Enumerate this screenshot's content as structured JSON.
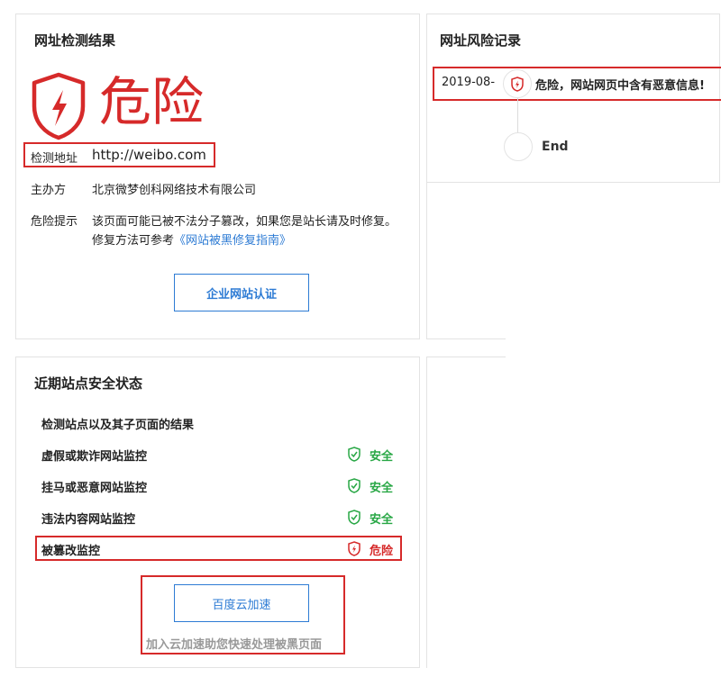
{
  "result": {
    "title": "网址检测结果",
    "verdict": "危险",
    "url_label": "检测地址",
    "url_value": "http://weibo.com",
    "owner_label": "主办方",
    "owner_value": "北京微梦创科网络技术有限公司",
    "tip_label": "危险提示",
    "tip_line1": "该页面可能已被不法分子篡改，如果您是站长请及时修复。",
    "tip_line2_prefix": "修复方法可参考",
    "tip_link": "《网站被黑修复指南》",
    "cert_button": "企业网站认证"
  },
  "history": {
    "title": "网址风险记录",
    "date": "2019-08-",
    "entry_text": "危险，网站网页中含有恶意信息!",
    "end_label": "End"
  },
  "status": {
    "title": "近期站点安全状态",
    "subtitle": "检测站点以及其子页面的结果",
    "rows": [
      {
        "label": "虚假或欺诈网站监控",
        "state": "安全"
      },
      {
        "label": "挂马或恶意网站监控",
        "state": "安全"
      },
      {
        "label": "违法内容网站监控",
        "state": "安全"
      },
      {
        "label": "被篡改监控",
        "state": "危险"
      }
    ],
    "accel_button": "百度云加速",
    "accel_note": "加入云加速助您快速处理被黑页面"
  },
  "colors": {
    "danger": "#d62a2a",
    "safe": "#28a745",
    "link": "#2d7bd4"
  }
}
